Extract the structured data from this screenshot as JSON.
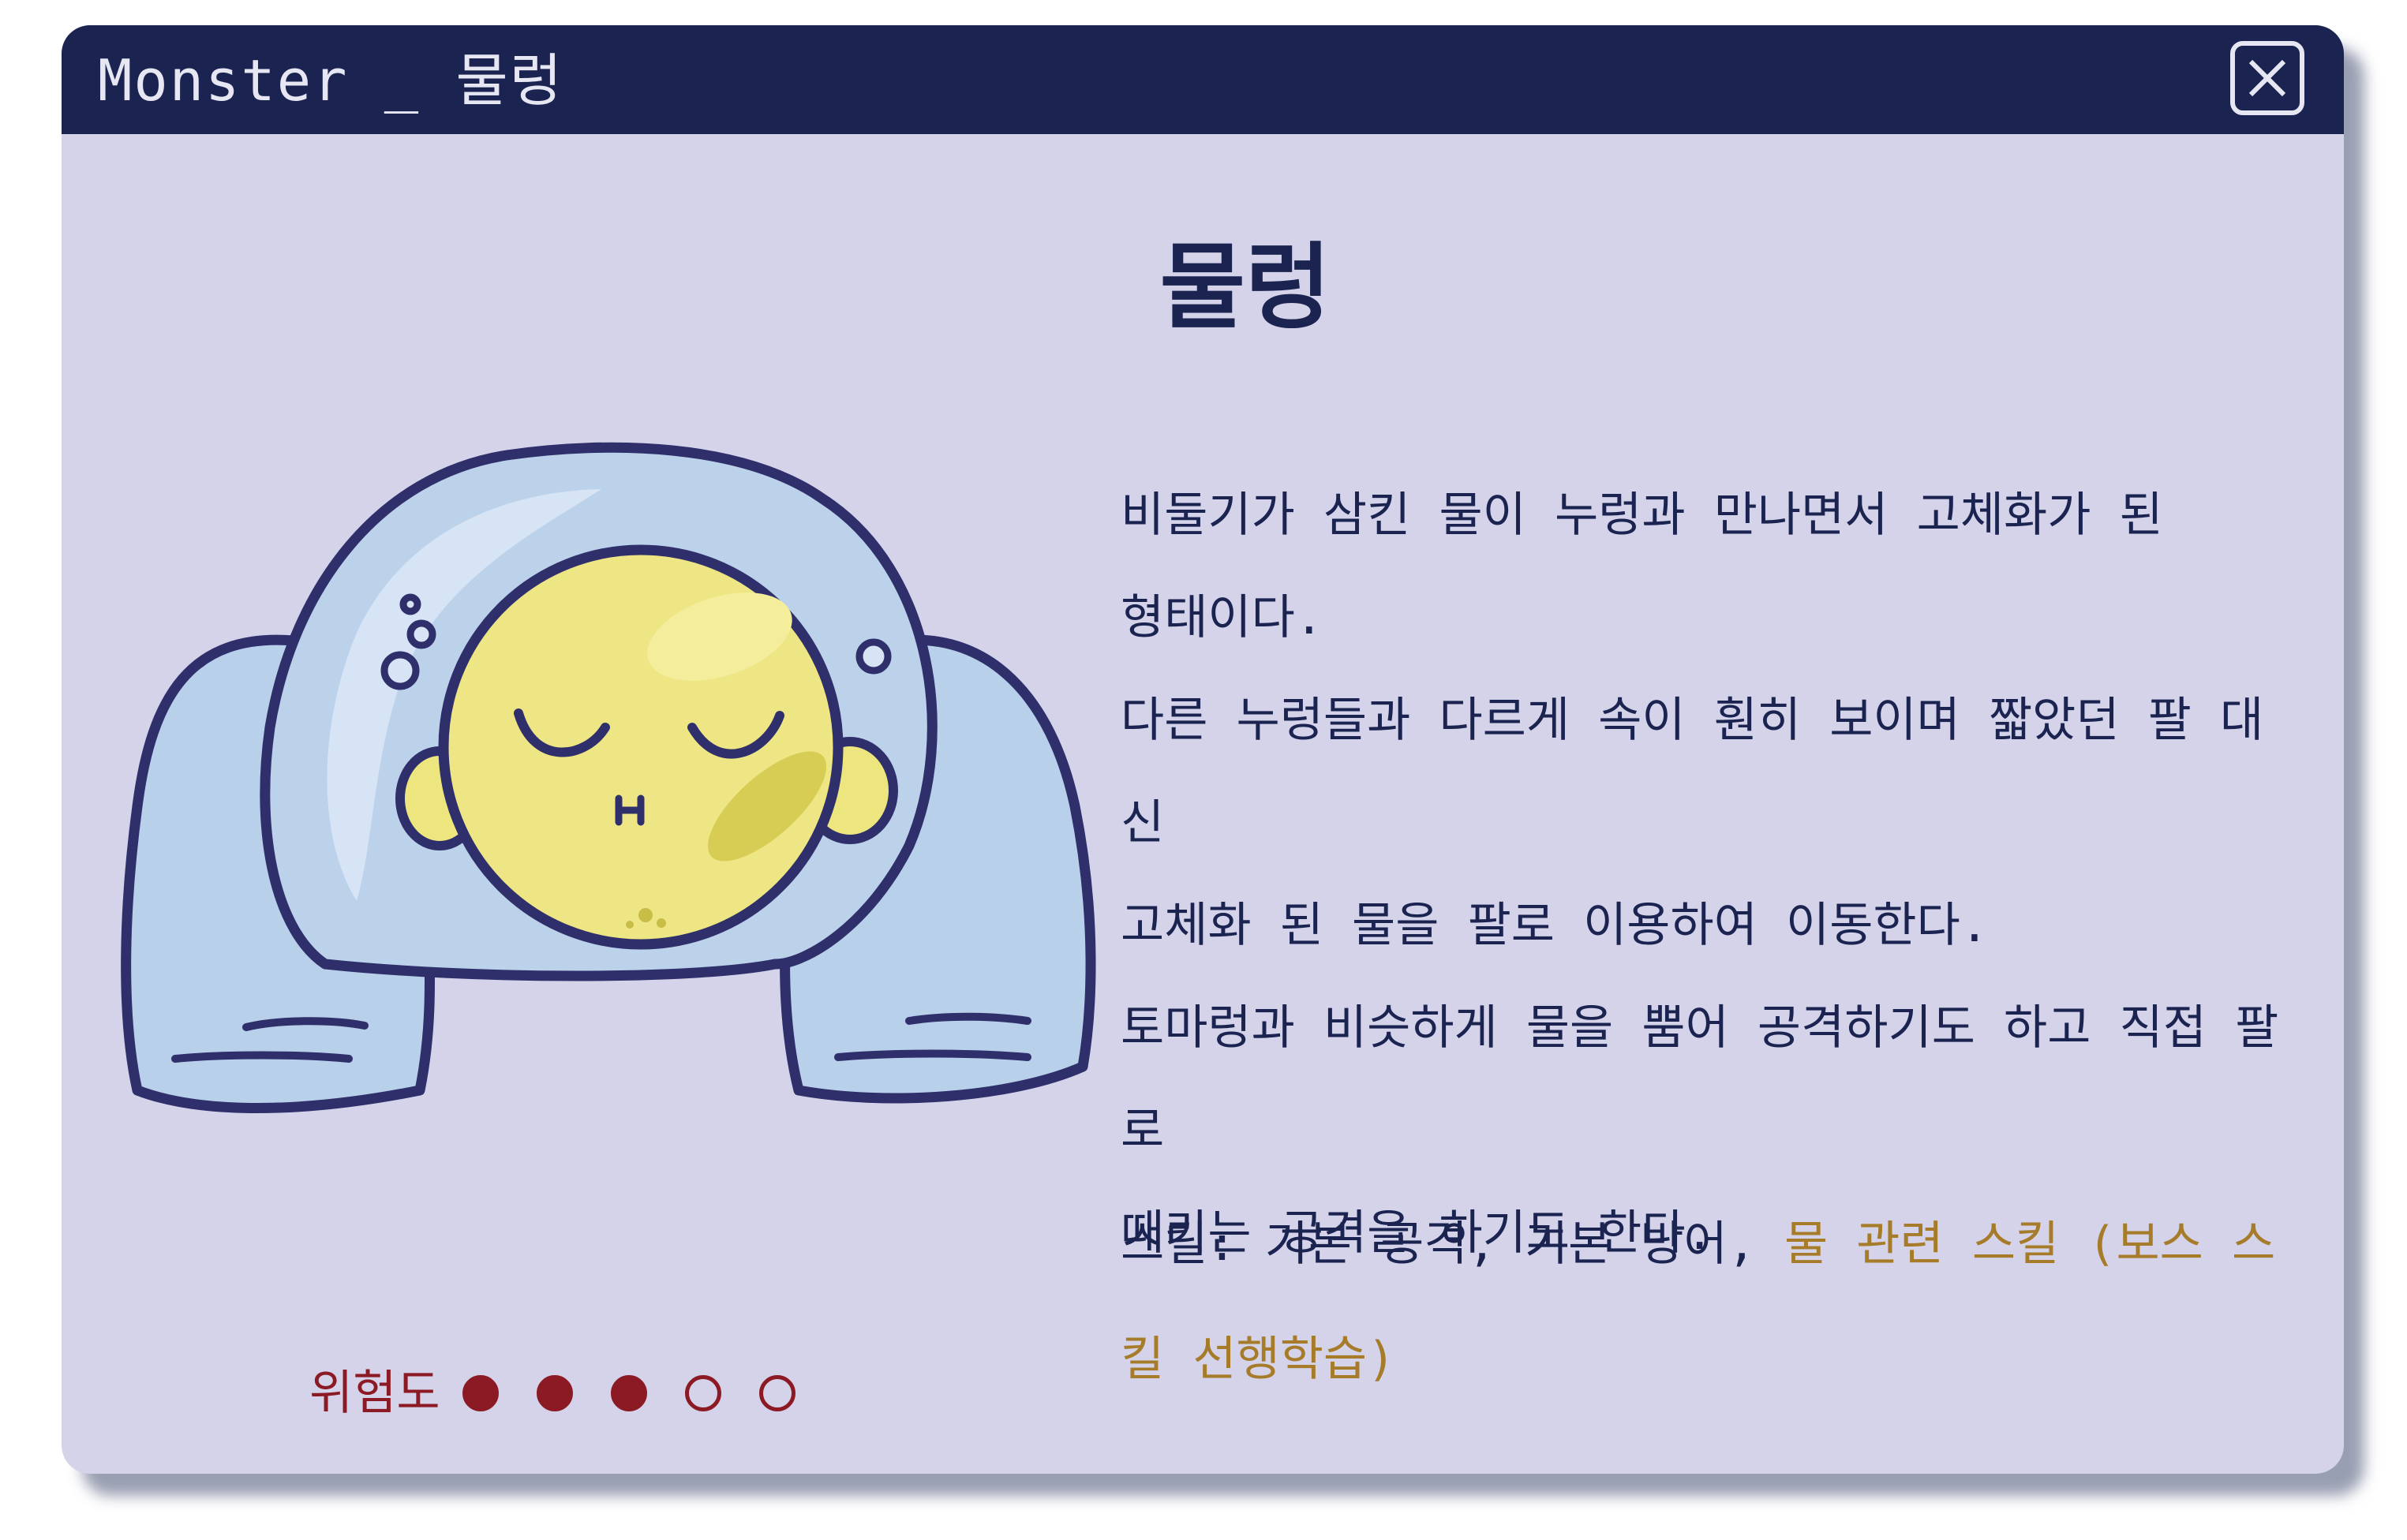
{
  "window": {
    "title": "Monster _ 물렁",
    "close_icon": "close-icon"
  },
  "monster": {
    "name": "물렁",
    "description": [
      "비둘기가 삼킨 물이 누렁과 만나면서 고체화가 된",
      "형태이다.",
      "다른 누렁들과 다르게 속이 훤히 보이며 짧았던 팔 대신",
      "고체화 된 물을 팔로 이용하여 이동한다.",
      "토마렁과 비슷하게 물을 뿜어 공격하기도 하고 직접 팔로",
      "때리는 공격을 하기도 한다."
    ],
    "skills_basic": "스킬: 기본 공격, 기본 방어, ",
    "skills_special": "물 관련 스킬 (보스 스킬 선행학습)",
    "danger_label": "위험도",
    "danger_level": 3,
    "danger_max": 5
  },
  "colors": {
    "titlebar": "#1b2451",
    "panel": "#d5d3e9",
    "text": "#1b2451",
    "special_skill": "#a67c2a",
    "danger": "#8b1a24"
  }
}
